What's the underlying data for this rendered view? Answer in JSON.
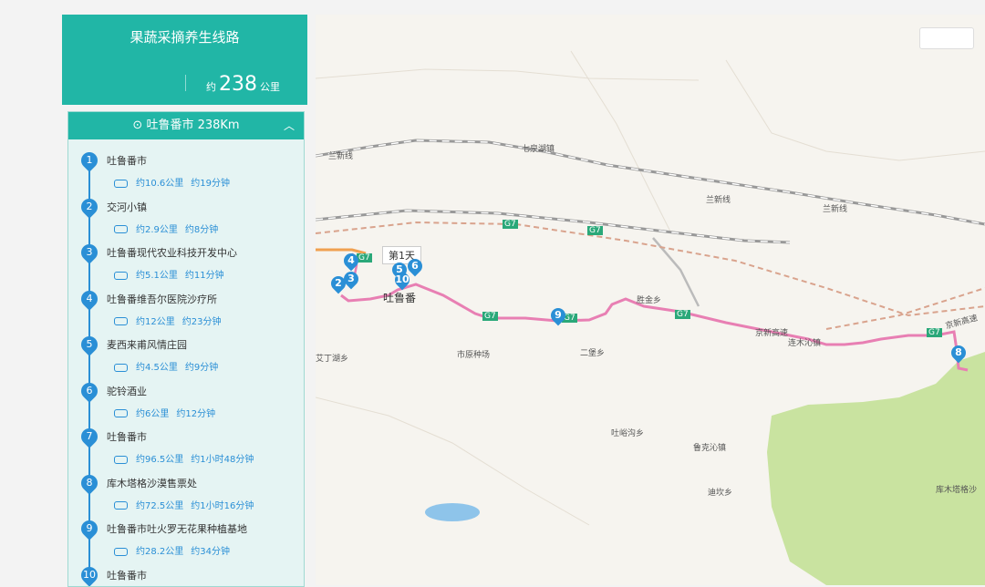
{
  "route": {
    "title": "果蔬采摘养生线路",
    "distance_prefix": "约",
    "distance_value": "238",
    "distance_unit": "公里"
  },
  "city_bar": {
    "label": "吐鲁番市  238Km",
    "icon": "location-pin-icon",
    "toggle_icon": "chevron-up-icon"
  },
  "stops": [
    {
      "num": "1",
      "name": "吐鲁番市",
      "dist": "约10.6公里",
      "time": "约19分钟"
    },
    {
      "num": "2",
      "name": "交河小镇",
      "dist": "约2.9公里",
      "time": "约8分钟"
    },
    {
      "num": "3",
      "name": "吐鲁番现代农业科技开发中心",
      "dist": "约5.1公里",
      "time": "约11分钟"
    },
    {
      "num": "4",
      "name": "吐鲁番维吾尔医院沙疗所",
      "dist": "约12公里",
      "time": "约23分钟"
    },
    {
      "num": "5",
      "name": "麦西来甫风情庄园",
      "dist": "约4.5公里",
      "time": "约9分钟"
    },
    {
      "num": "6",
      "name": "驼铃酒业",
      "dist": "约6公里",
      "time": "约12分钟"
    },
    {
      "num": "7",
      "name": "吐鲁番市",
      "dist": "约96.5公里",
      "time": "约1小时48分钟"
    },
    {
      "num": "8",
      "name": "库木塔格沙漠售票处",
      "dist": "约72.5公里",
      "time": "约1小时16分钟"
    },
    {
      "num": "9",
      "name": "吐鲁番市吐火罗无花果种植基地",
      "dist": "约28.2公里",
      "time": "约34分钟"
    },
    {
      "num": "10",
      "name": "吐鲁番市",
      "dist": "",
      "time": ""
    }
  ],
  "map": {
    "day_tag": "第1天",
    "labels": {
      "lanxin1": "兰新线",
      "qikesu": "七泉湖镇",
      "lanxin2": "兰新线",
      "lanxin3": "兰新线",
      "g7a": "G7",
      "g7b": "G7",
      "g7c": "G7",
      "g7d": "G7",
      "g7e": "G7",
      "g7f": "G7",
      "g7g": "G7",
      "turpan": "吐鲁番",
      "shengjin": "胜金乡",
      "jingxin1": "京新高速",
      "jingxin2": "京新高速",
      "lianmuqin": "连木沁镇",
      "aiding": "艾丁湖乡",
      "yuanzhong": "市原种场",
      "erbao": "二堡乡",
      "tuyugou": "吐峪沟乡",
      "lukeqin": "鲁克沁镇",
      "dikan": "迪坎乡",
      "kumtag": "库木塔格沙"
    },
    "pins": [
      "1",
      "2",
      "3",
      "4",
      "5",
      "6",
      "7",
      "8",
      "9",
      "10"
    ],
    "colors": {
      "route": "#e87fb3",
      "pin": "#2a8fd6",
      "desert": "#c9e3a0",
      "lake": "#8ec4ea",
      "header": "#21b6a6"
    }
  }
}
